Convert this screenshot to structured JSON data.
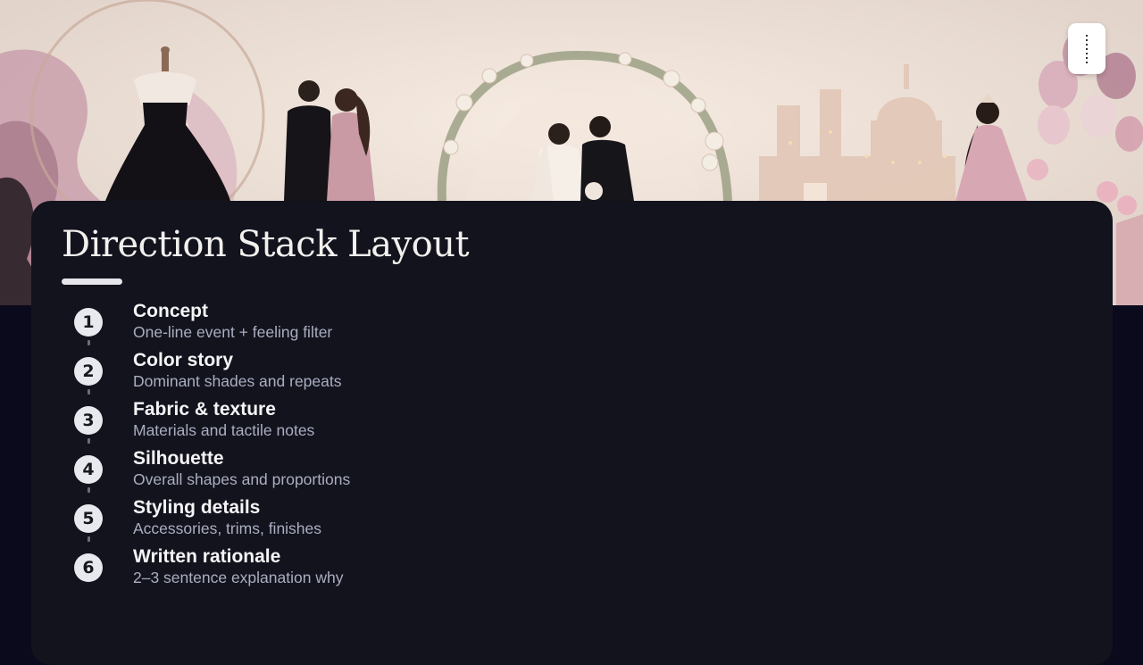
{
  "slide": {
    "title": "Direction Stack Layout",
    "colors": {
      "card_background": "#13131e",
      "page_background": "#0b0a1c",
      "title": "#f2f0ee",
      "step_badge": "#e8e9ef",
      "step_description": "#a9aec0"
    }
  },
  "banner": {
    "scene": [
      "mannequin-black-gown",
      "couple-formal",
      "floral-arch",
      "bride-and-groom",
      "castle",
      "quinceanera-girl",
      "balloons",
      "roses"
    ]
  },
  "logo": {
    "icon": "logo-mark"
  },
  "steps": [
    {
      "number": "1",
      "title": "Concept",
      "description": "One-line event + feeling filter"
    },
    {
      "number": "2",
      "title": "Color story",
      "description": "Dominant shades and repeats"
    },
    {
      "number": "3",
      "title": "Fabric & texture",
      "description": "Materials and tactile notes"
    },
    {
      "number": "4",
      "title": "Silhouette",
      "description": "Overall shapes and proportions"
    },
    {
      "number": "5",
      "title": "Styling details",
      "description": "Accessories, trims, finishes"
    },
    {
      "number": "6",
      "title": "Written rationale",
      "description": "2–3 sentence explanation why"
    }
  ]
}
